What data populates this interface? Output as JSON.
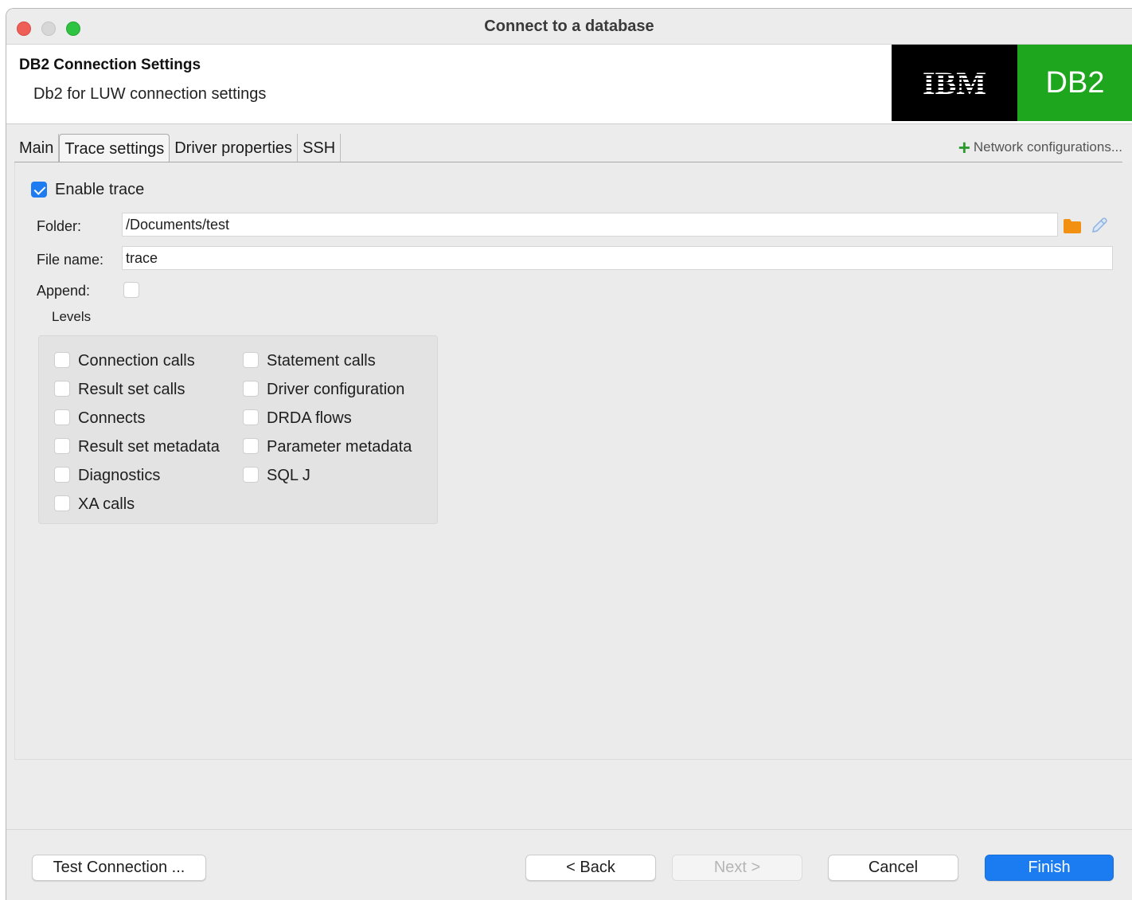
{
  "window": {
    "title": "Connect to a database"
  },
  "header": {
    "title": "DB2 Connection Settings",
    "subtitle": "Db2 for LUW connection settings",
    "logo_ibm": "IBM",
    "logo_db2": "DB2",
    "colors": {
      "ibm_bg": "#000000",
      "db2_bg": "#1fa61f"
    }
  },
  "tabs": [
    {
      "label": "Main",
      "active": false
    },
    {
      "label": "Trace settings",
      "active": true
    },
    {
      "label": "Driver properties",
      "active": false
    },
    {
      "label": "SSH",
      "active": false
    }
  ],
  "network_config": {
    "label": "Network configurations..."
  },
  "trace": {
    "enable_label": "Enable trace",
    "enabled": true,
    "folder_label": "Folder:",
    "folder_value": "/Documents/test",
    "filename_label": "File name:",
    "filename_value": "trace",
    "append_label": "Append:",
    "append": false,
    "levels_label": "Levels",
    "levels_left": [
      {
        "label": "Connection calls",
        "checked": false
      },
      {
        "label": "Result set calls",
        "checked": false
      },
      {
        "label": "Connects",
        "checked": false
      },
      {
        "label": "Result set metadata",
        "checked": false
      },
      {
        "label": "Diagnostics",
        "checked": false
      },
      {
        "label": "XA calls",
        "checked": false
      }
    ],
    "levels_right": [
      {
        "label": "Statement calls",
        "checked": false
      },
      {
        "label": "Driver configuration",
        "checked": false
      },
      {
        "label": "DRDA flows",
        "checked": false
      },
      {
        "label": "Parameter metadata",
        "checked": false
      },
      {
        "label": "SQL J",
        "checked": false
      }
    ]
  },
  "footer": {
    "test_connection": "Test Connection ...",
    "back": "< Back",
    "next": "Next >",
    "cancel": "Cancel",
    "finish": "Finish",
    "accent_color": "#1b7cf2"
  }
}
